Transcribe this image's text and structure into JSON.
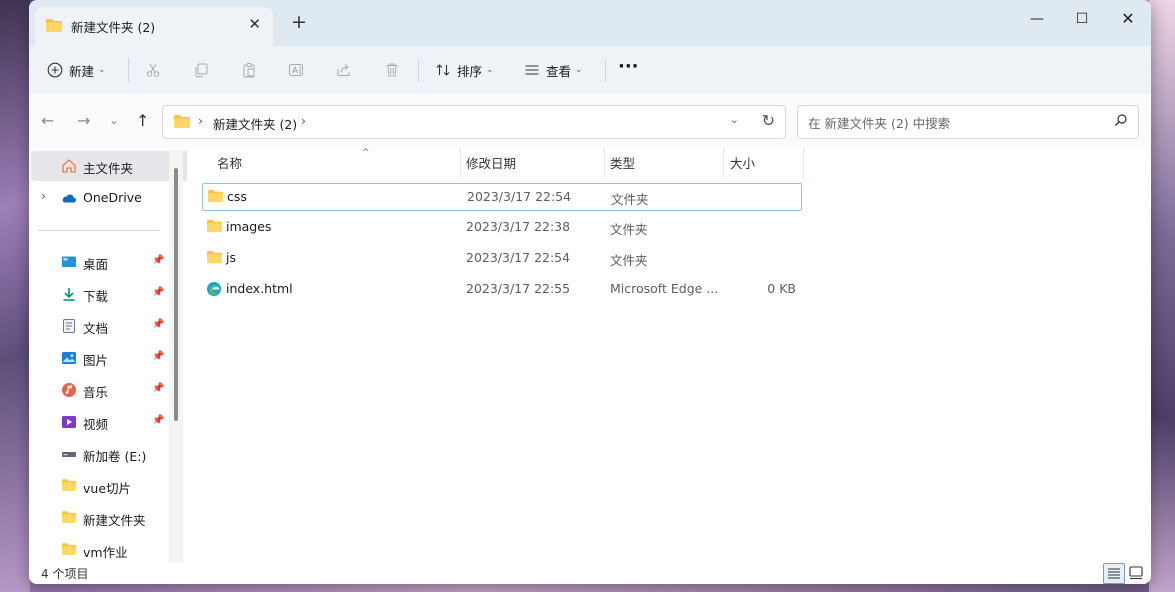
{
  "window": {
    "tab_title": "新建文件夹 (2)",
    "new_tab_symbol": "+",
    "close_tab_symbol": "✕",
    "minimize_symbol": "—",
    "maximize_symbol": "☐",
    "close_symbol": "✕"
  },
  "toolbar": {
    "new_label": "新建",
    "sort_label": "排序",
    "view_label": "查看",
    "more_symbol": "···",
    "icons": [
      "cut-icon",
      "copy-icon",
      "paste-icon",
      "rename-icon",
      "share-icon",
      "delete-icon"
    ]
  },
  "address": {
    "path": "新建文件夹 (2)",
    "separator": "›",
    "search_placeholder": "在 新建文件夹 (2) 中搜索"
  },
  "sidebar": {
    "home": "主文件夹",
    "onedrive": "OneDrive",
    "items": [
      {
        "label": "桌面",
        "icon": "desktop-icon",
        "pinned": true
      },
      {
        "label": "下载",
        "icon": "download-icon",
        "pinned": true
      },
      {
        "label": "文档",
        "icon": "document-icon",
        "pinned": true
      },
      {
        "label": "图片",
        "icon": "picture-icon",
        "pinned": true
      },
      {
        "label": "音乐",
        "icon": "music-icon",
        "pinned": true
      },
      {
        "label": "视频",
        "icon": "video-icon",
        "pinned": true
      },
      {
        "label": "新加卷 (E:)",
        "icon": "drive-icon",
        "pinned": false
      },
      {
        "label": "vue切片",
        "icon": "folder-icon",
        "pinned": false
      },
      {
        "label": "新建文件夹",
        "icon": "folder-icon",
        "pinned": false
      },
      {
        "label": "vm作业",
        "icon": "folder-icon",
        "pinned": false
      }
    ]
  },
  "columns": {
    "name": "名称",
    "modified": "修改日期",
    "type": "类型",
    "size": "大小"
  },
  "files": [
    {
      "name": "css",
      "modified": "2023/3/17 22:54",
      "type": "文件夹",
      "size": "",
      "icon": "folder-icon"
    },
    {
      "name": "images",
      "modified": "2023/3/17 22:38",
      "type": "文件夹",
      "size": "",
      "icon": "folder-icon"
    },
    {
      "name": "js",
      "modified": "2023/3/17 22:54",
      "type": "文件夹",
      "size": "",
      "icon": "folder-icon"
    },
    {
      "name": "index.html",
      "modified": "2023/3/17 22:55",
      "type": "Microsoft Edge ...",
      "size": "0 KB",
      "icon": "edge-icon"
    }
  ],
  "status": {
    "count": "4 个项目"
  },
  "colors": {
    "titlebar": "#dfe9f2",
    "toolbar": "#eef3f8",
    "folder": "#f6c343",
    "selection_border": "#92c3e8"
  }
}
